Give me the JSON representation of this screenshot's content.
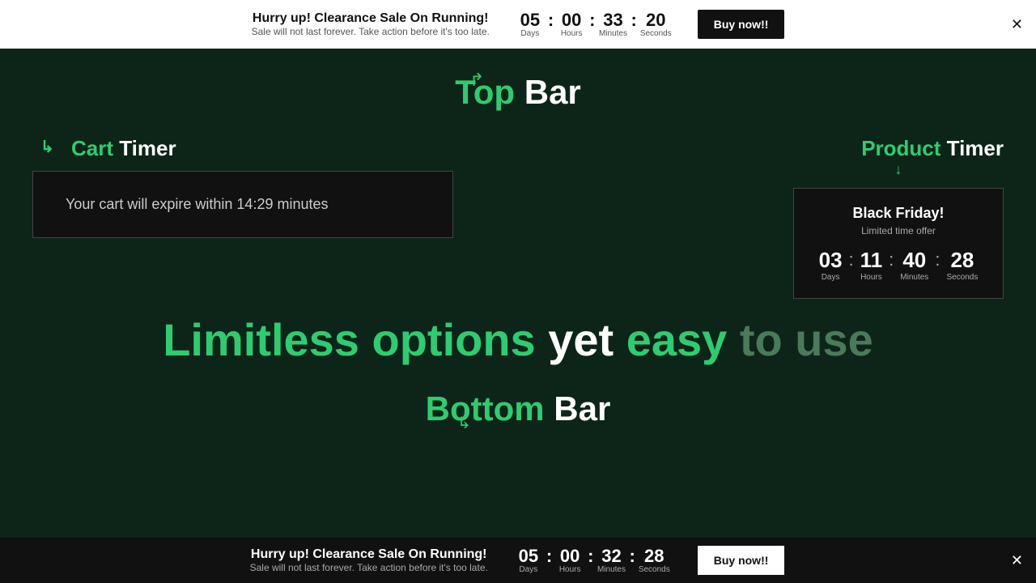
{
  "topBar": {
    "title": "Hurry up! Clearance Sale On Running!",
    "subtitle": "Sale will not last forever. Take action before it's too late.",
    "countdown": {
      "days": "05",
      "hours": "00",
      "minutes": "33",
      "seconds": "20",
      "daysLabel": "Days",
      "hoursLabel": "Hours",
      "minutesLabel": "Minutes",
      "secondsLabel": "Seconds"
    },
    "buyButton": "Buy now!!"
  },
  "topBarLabel": {
    "greenText": "Top",
    "whiteText": " Bar"
  },
  "cartTimer": {
    "labelGreen": "Cart",
    "labelWhite": " Timer",
    "message": "Your cart  will expire within 14:29 minutes"
  },
  "productTimer": {
    "labelGreen": "Product",
    "labelWhite": " Timer",
    "heading": "Black Friday!",
    "subtitle": "Limited time offer",
    "countdown": {
      "days": "03",
      "hours": "11",
      "minutes": "40",
      "seconds": "28",
      "daysLabel": "Days",
      "hoursLabel": "Hours",
      "minutesLabel": "Minutes",
      "secondsLabel": "Seconds"
    }
  },
  "slogan": {
    "line1Green": "Limitless options",
    "line1White": " yet ",
    "line2Green": "easy",
    "line2Muted": " to use"
  },
  "bottomBarLabel": {
    "greenText": "Bottom",
    "whiteText": " Bar"
  },
  "bottomBar": {
    "title": "Hurry up! Clearance Sale On Running!",
    "subtitle": "Sale will not last forever. Take action before it's too late.",
    "countdown": {
      "days": "05",
      "hours": "00",
      "minutes": "32",
      "seconds": "28",
      "daysLabel": "Days",
      "hoursLabel": "Hours",
      "minutesLabel": "Minutes",
      "secondsLabel": "Seconds"
    },
    "buyButton": "Buy now!!"
  }
}
